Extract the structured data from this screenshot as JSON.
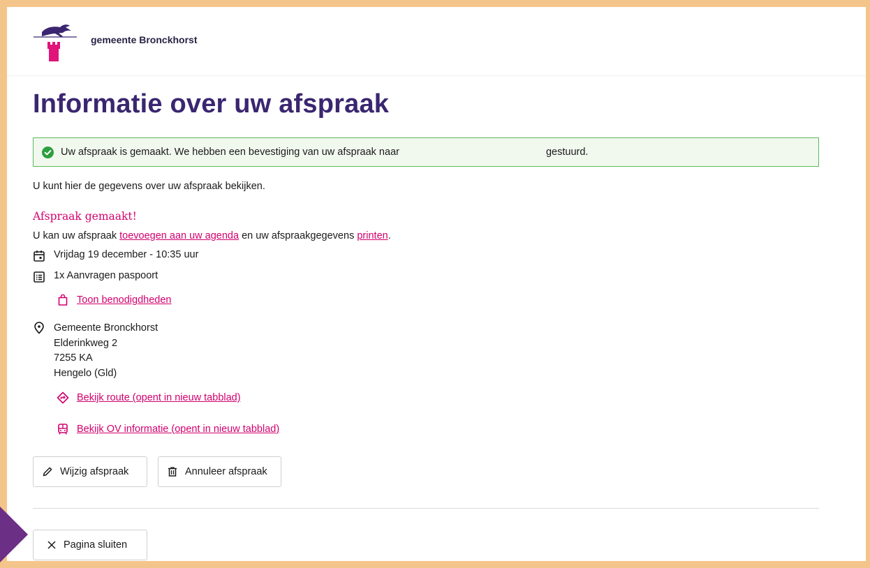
{
  "brand": {
    "name": "gemeente Bronckhorst",
    "logo_icon": "hare-castle-logo"
  },
  "page": {
    "title": "Informatie over uw afspraak"
  },
  "alert": {
    "text_before": "Uw afspraak is gemaakt. We hebben een bevestiging van uw afspraak naar",
    "text_after": "gestuurd.",
    "icon": "check-circle-icon",
    "color": "#5cb85c"
  },
  "intro": "U kunt hier de gegevens over uw afspraak bekijken.",
  "confirmation": {
    "title": "Afspraak gemaakt!",
    "line_before": "U kan uw afspraak",
    "agenda_link": "toevoegen aan uw agenda",
    "line_middle": "en uw afspraakgegevens",
    "print_link": "printen",
    "line_end": "."
  },
  "appointment": {
    "datetime": "Vrijdag 19 december - 10:35 uur",
    "product": "1x Aanvragen paspoort",
    "requirements_link": "Toon benodigdheden"
  },
  "location": {
    "name": "Gemeente Bronckhorst",
    "street": "Elderinkweg 2",
    "postcode": "7255 KA",
    "city": "Hengelo (Gld)",
    "route_link": "Bekijk route (opent in nieuw tabblad)",
    "ov_link": "Bekijk OV informatie (opent in nieuw tabblad)"
  },
  "actions": {
    "edit": "Wijzig afspraak",
    "cancel": "Annuleer afspraak",
    "close": "Pagina sluiten"
  },
  "colors": {
    "accent": "#d2006e",
    "heading": "#3a2670",
    "frame": "#f4c58a",
    "corner": "#6b2f86"
  }
}
